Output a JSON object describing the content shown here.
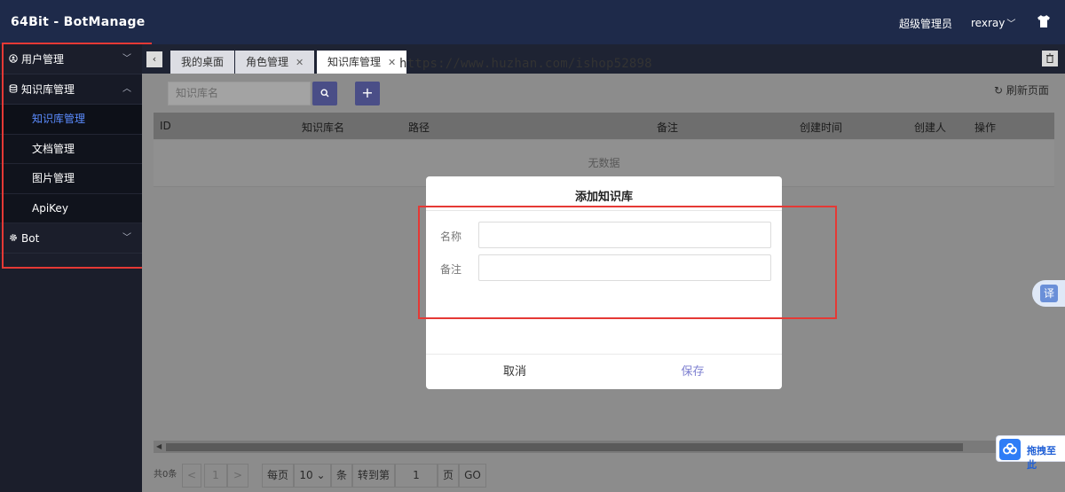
{
  "header": {
    "app_title": "64Bit - BotManage",
    "role": "超级管理员",
    "username": "rexray",
    "caret": "﹀"
  },
  "sidebar": {
    "items": [
      {
        "label": "用户管理",
        "icon": "user-circle-icon",
        "chevron": "﹀"
      },
      {
        "label": "知识库管理",
        "icon": "database-icon",
        "chevron": "︿"
      },
      {
        "label": "Bot",
        "icon": "gear-icon",
        "chevron": "﹀"
      }
    ],
    "sub_items": [
      "知识库管理",
      "文档管理",
      "图片管理",
      "ApiKey"
    ]
  },
  "tabs": [
    {
      "label": "我的桌面"
    },
    {
      "label": "角色管理",
      "close": "✕"
    },
    {
      "label": "知识库管理",
      "close": "✕"
    }
  ],
  "tab_prev": "‹",
  "tab_trash": "🗑",
  "watermark": "https://www.huzhan.com/ishop52898",
  "toolbar": {
    "search_placeholder": "知识库名",
    "search_icon": "⌕",
    "add_icon": "+",
    "refresh_icon": "↻",
    "refresh_label": "刷新页面"
  },
  "table": {
    "columns": [
      "ID",
      "知识库名",
      "路径",
      "备注",
      "创建时间",
      "创建人",
      "操作"
    ],
    "empty_text": "无数据"
  },
  "pagination": {
    "total": "共0条",
    "prev": "<",
    "page": "1",
    "next": ">",
    "per_page_label": "每页",
    "per_page": "10",
    "per_page_caret": "⌄",
    "unit": "条",
    "goto_label": "转到第",
    "goto_value": "1",
    "page_unit": "页",
    "go": "GO"
  },
  "modal": {
    "title": "添加知识库",
    "name_label": "名称",
    "note_label": "备注",
    "cancel": "取消",
    "save": "保存"
  },
  "translate_label": "译",
  "drag_label": "拖拽至此",
  "colors": {
    "header_bg": "#1e2a4a",
    "sidebar_bg": "#1b1e2b",
    "active_menu": "#5b8cff",
    "primary_btn": "#4a4e87",
    "annotation_red": "#e53935"
  }
}
